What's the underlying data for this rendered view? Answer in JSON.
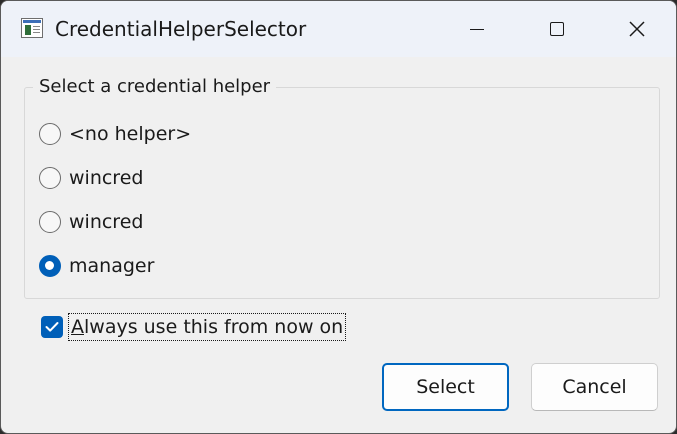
{
  "window": {
    "title": "CredentialHelperSelector",
    "icon": "application-window-icon",
    "caption_buttons": [
      "minimize-icon",
      "maximize-icon",
      "close-icon"
    ]
  },
  "group": {
    "label": "Select a credential helper",
    "options": [
      {
        "label": "<no helper>",
        "checked": false
      },
      {
        "label": "wincred",
        "checked": false
      },
      {
        "label": "wincred",
        "checked": false
      },
      {
        "label": "manager",
        "checked": true
      }
    ]
  },
  "remember": {
    "label_accel": "A",
    "label_rest": "lways use this from now on",
    "checked": true
  },
  "buttons": {
    "select": "Select",
    "cancel": "Cancel"
  },
  "colors": {
    "accent": "#005fb8",
    "dialog_bg": "#f0f0f0",
    "titlebar_bg": "#eef2f9"
  }
}
